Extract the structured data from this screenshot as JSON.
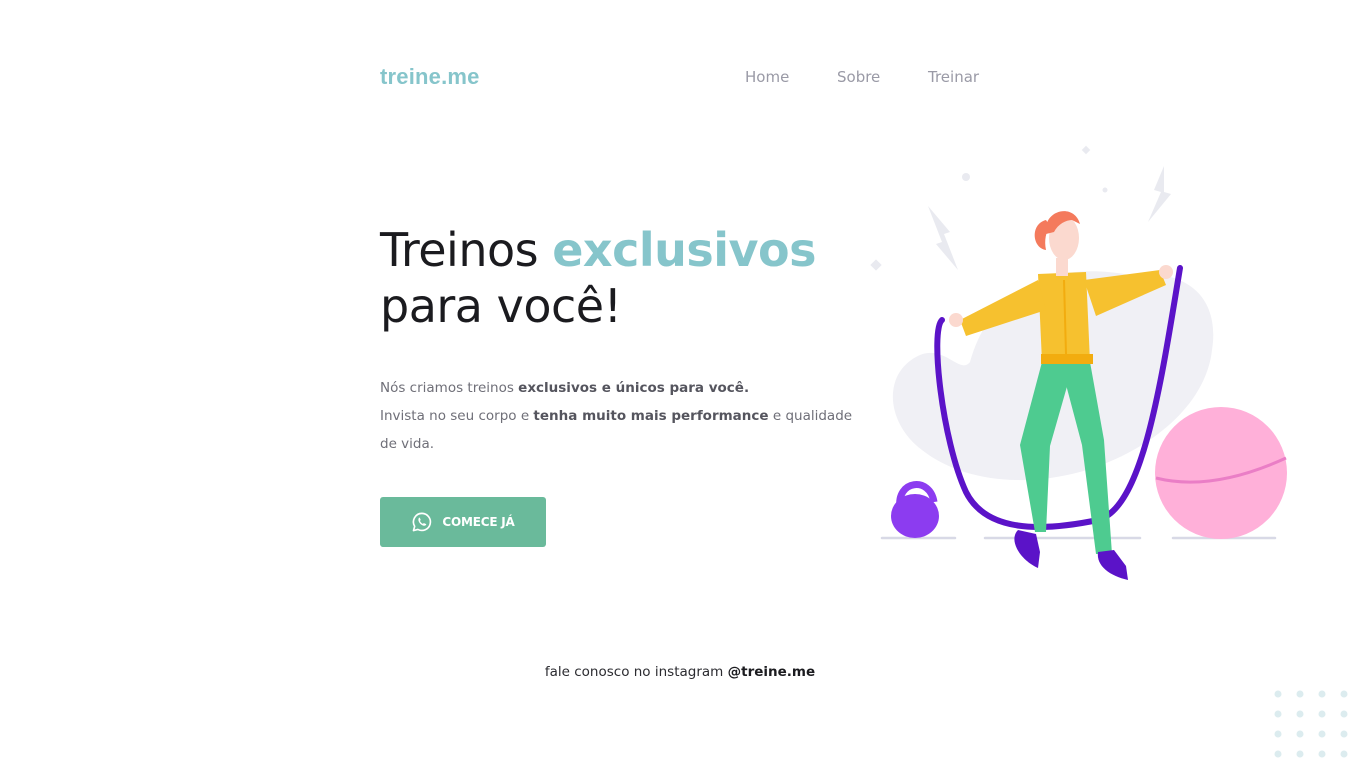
{
  "header": {
    "logo": "treine.me",
    "nav": [
      {
        "label": "Home"
      },
      {
        "label": "Sobre"
      },
      {
        "label": "Treinar"
      }
    ]
  },
  "hero": {
    "title_part1": "Treinos ",
    "title_accent": "exclusivos",
    "title_line2": "para você!",
    "desc": {
      "line1_plain": "Nós criamos treinos ",
      "line1_bold": "exclusivos e únicos para você.",
      "line2_plain1": "Invista no seu corpo e ",
      "line2_bold": "tenha muito mais performance",
      "line2_plain2": " e qualidade de vida."
    },
    "cta_label": "COMECE JÁ",
    "cta_icon": "whatsapp-icon"
  },
  "illustration": {
    "icon": "woman-jumping-rope-illustration",
    "colors": {
      "hair": "#f47a5c",
      "jacket": "#f6c12f",
      "pants": "#4ecb90",
      "rope": "#5b13c8",
      "kettlebell": "#8c3cf0",
      "ball": "#ffb0d9",
      "blob": "#f0f0f5"
    }
  },
  "footer": {
    "text": "fale conosco no instagram ",
    "handle": "@treine.me"
  },
  "colors": {
    "brand": "#86c5cb",
    "button": "#6aba9b",
    "heading": "#1b1b1f",
    "body_text": "#6f6f78",
    "nav_text": "#9a9aa6"
  }
}
